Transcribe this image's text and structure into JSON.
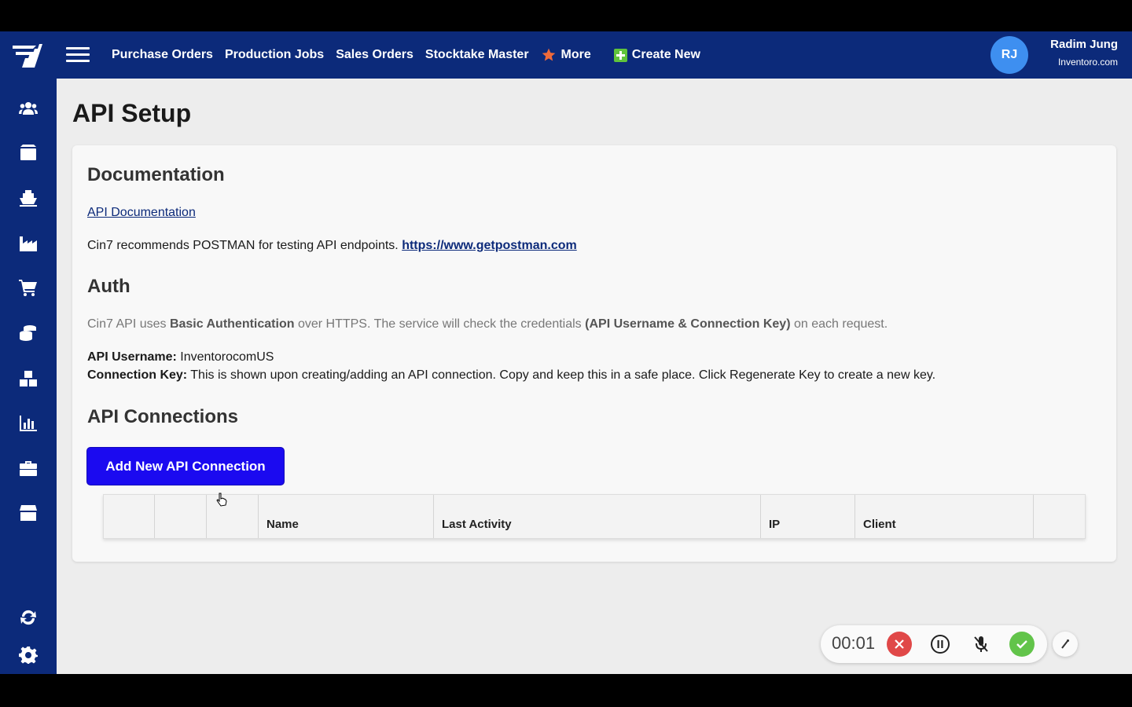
{
  "topbar": {
    "nav": [
      "Purchase Orders",
      "Production Jobs",
      "Sales Orders",
      "Stocktake Master"
    ],
    "more_label": "More",
    "create_label": "Create New",
    "avatar_initials": "RJ",
    "user_name": "Radim Jung",
    "user_org": "Inventoro.com"
  },
  "sidebar": {
    "icons": [
      "users-icon",
      "box-icon",
      "ship-icon",
      "factory-icon",
      "cart-icon",
      "coins-icon",
      "boxes-icon",
      "chart-icon",
      "briefcase-icon",
      "store-icon",
      "sync-icon",
      "gear-icon"
    ]
  },
  "page": {
    "title": "API Setup",
    "documentation_heading": "Documentation",
    "api_doc_link": "API Documentation",
    "postman_text": "Cin7 recommends POSTMAN for testing API endpoints.",
    "postman_link": "https://www.getpostman.com",
    "auth_heading": "Auth",
    "auth_pre": "Cin7 API uses",
    "auth_bold1": "Basic Authentication",
    "auth_mid": "over HTTPS. The service will check the credentials",
    "auth_bold2": "(API Username & Connection Key)",
    "auth_post": "on each request.",
    "username_label": "API Username:",
    "username_value": "InventorocomUS",
    "key_label": "Connection Key:",
    "key_value": "This is shown upon creating/adding an API connection. Copy and keep this in a safe place. Click Regenerate Key to create a new key.",
    "connections_heading": "API Connections",
    "add_button": "Add New API Connection",
    "table_headers": [
      "",
      "",
      "",
      "Name",
      "Last Activity",
      "IP",
      "Client",
      ""
    ]
  },
  "recorder": {
    "time": "00:01"
  },
  "colors": {
    "navy": "#0c2a7a",
    "button_blue": "#1b0af0",
    "avatar_blue": "#3e8ff0",
    "star_orange": "#f06a3a",
    "plus_green": "#5fc43b",
    "stop_red": "#e04848",
    "done_green": "#62c44a"
  }
}
